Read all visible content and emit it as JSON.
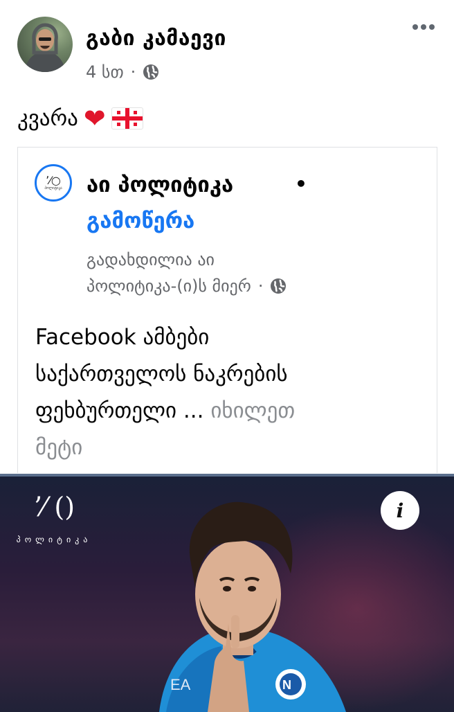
{
  "post": {
    "author": "გაბი კამაევი",
    "time": "4 სთ",
    "separator": "·",
    "privacy_icon": "globe-icon",
    "more_icon": "ellipsis-icon",
    "caption": "კვარა",
    "emoji": [
      "red-heart",
      "georgia-flag"
    ]
  },
  "shared": {
    "page_name": "აი პოლიტიკა",
    "bullet": "•",
    "follow_label": "გამოწერა",
    "paid_by_line1": "გადახდილია აი",
    "paid_by_line2": "პოლიტიკა-(ი)ს მიერ",
    "separator": "·",
    "privacy_icon": "globe-icon",
    "body_line1": "Facebook ამბები",
    "body_line2": " საქართველოს ნაკრების",
    "body_line3": "ფეხბურთელი ...",
    "see_more_part1": "იხილეთ",
    "see_more_part2": "მეტი"
  },
  "media": {
    "logo_mark": "ʼ⁄ ()",
    "logo_text": "პოლიტიკა",
    "info_label": "i"
  },
  "colors": {
    "accent": "#1877f2",
    "secondary_text": "#65676b",
    "heart": "#e0162b"
  }
}
